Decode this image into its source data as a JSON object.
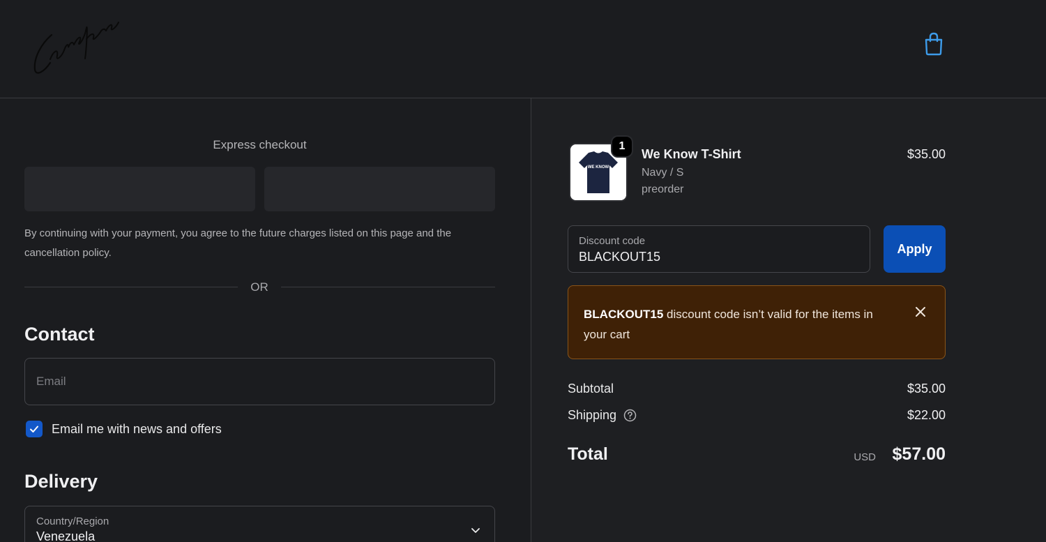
{
  "brand": {
    "logo_text": "Candace"
  },
  "header": {
    "cart_icon": "shopping-bag-icon"
  },
  "express": {
    "title": "Express checkout",
    "consent_text": "By continuing with your payment, you agree to the future charges listed on this page and the cancellation policy.",
    "or_label": "OR"
  },
  "contact": {
    "title": "Contact",
    "email_placeholder": "Email",
    "email_value": "",
    "newsletter_label": "Email me with news and offers",
    "newsletter_checked": true
  },
  "delivery": {
    "title": "Delivery",
    "country_label": "Country/Region",
    "country_value": "Venezuela"
  },
  "cart": {
    "item": {
      "name": "We Know T-Shirt",
      "variant": "Navy / S",
      "note": "preorder",
      "price": "$35.00",
      "quantity": "1",
      "shirt_print": "WE KNOW"
    },
    "discount": {
      "label": "Discount code",
      "value": "BLACKOUT15",
      "apply_label": "Apply"
    },
    "alert": {
      "code": "BLACKOUT15",
      "message": " discount code isn’t valid for the items in your cart"
    },
    "summary": {
      "subtotal_label": "Subtotal",
      "subtotal_value": "$35.00",
      "shipping_label": "Shipping",
      "shipping_value": "$22.00",
      "total_label": "Total",
      "currency": "USD",
      "total_value": "$57.00"
    }
  },
  "colors": {
    "background": "#1b1c1f",
    "accent_blue": "#0b4fb5",
    "cart_icon": "#3d9be9",
    "alert_bg": "#3f2106",
    "alert_border": "#8a5418"
  }
}
